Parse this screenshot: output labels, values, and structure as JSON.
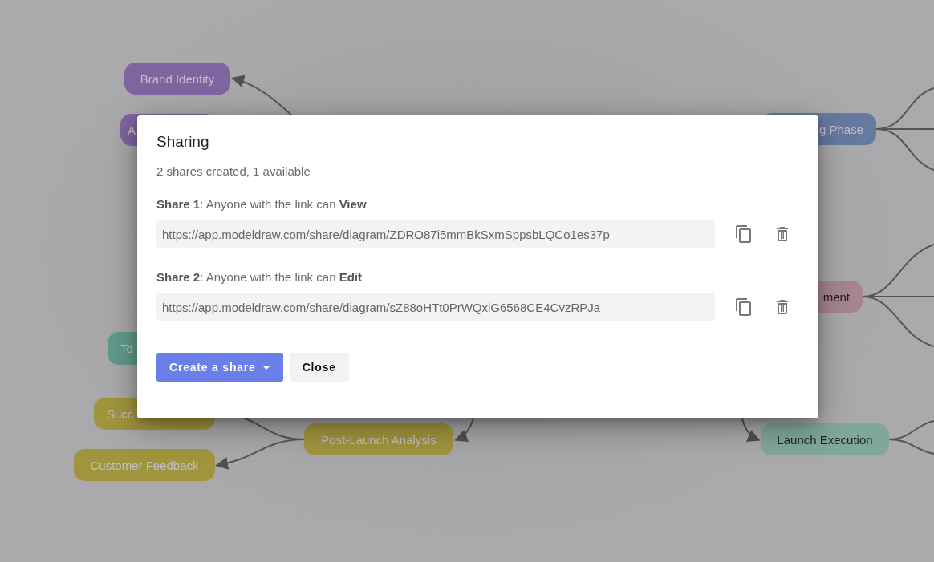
{
  "canvas": {
    "nodes": [
      {
        "label": "Brand Identity",
        "color": "#7f64a0",
        "kind": "light"
      },
      {
        "label": "A",
        "color": "#7f64a0",
        "kind": "light"
      },
      {
        "label": "g Phase",
        "color": "#6679a0",
        "kind": "light"
      },
      {
        "label": "ment",
        "color": "#a68593",
        "kind": "dark"
      },
      {
        "label": "To",
        "color": "#5f9a8a",
        "kind": "light"
      },
      {
        "label": "Succ",
        "color": "#a0943c",
        "kind": "light"
      },
      {
        "label": "Customer Feedback",
        "color": "#a0943c",
        "kind": "light"
      },
      {
        "label": "Post-Launch Analysis",
        "color": "#a0943c",
        "kind": "light"
      },
      {
        "label": "Launch Execution",
        "color": "#80a79b",
        "kind": "dark"
      }
    ]
  },
  "dialog": {
    "title": "Sharing",
    "summary": "2 shares created, 1 available",
    "shares": [
      {
        "caption": "**Share 1**: Anyone with the link can **View**",
        "url": "https://app.modeldraw.com/share/diagram/ZDRO87i5mmBkSxmSppsbLQCo1es37p"
      },
      {
        "caption": "**Share 2**: Anyone with the link can **Edit**",
        "url": "https://app.modeldraw.com/share/diagram/sZ88oHTt0PrWQxiG6568CE4CvzRPJa"
      }
    ],
    "buttons": [
      {
        "label": "Create a share",
        "kind": "primary",
        "dropdown": true
      },
      {
        "label": "Close",
        "kind": "secondary",
        "dropdown": false
      }
    ]
  }
}
